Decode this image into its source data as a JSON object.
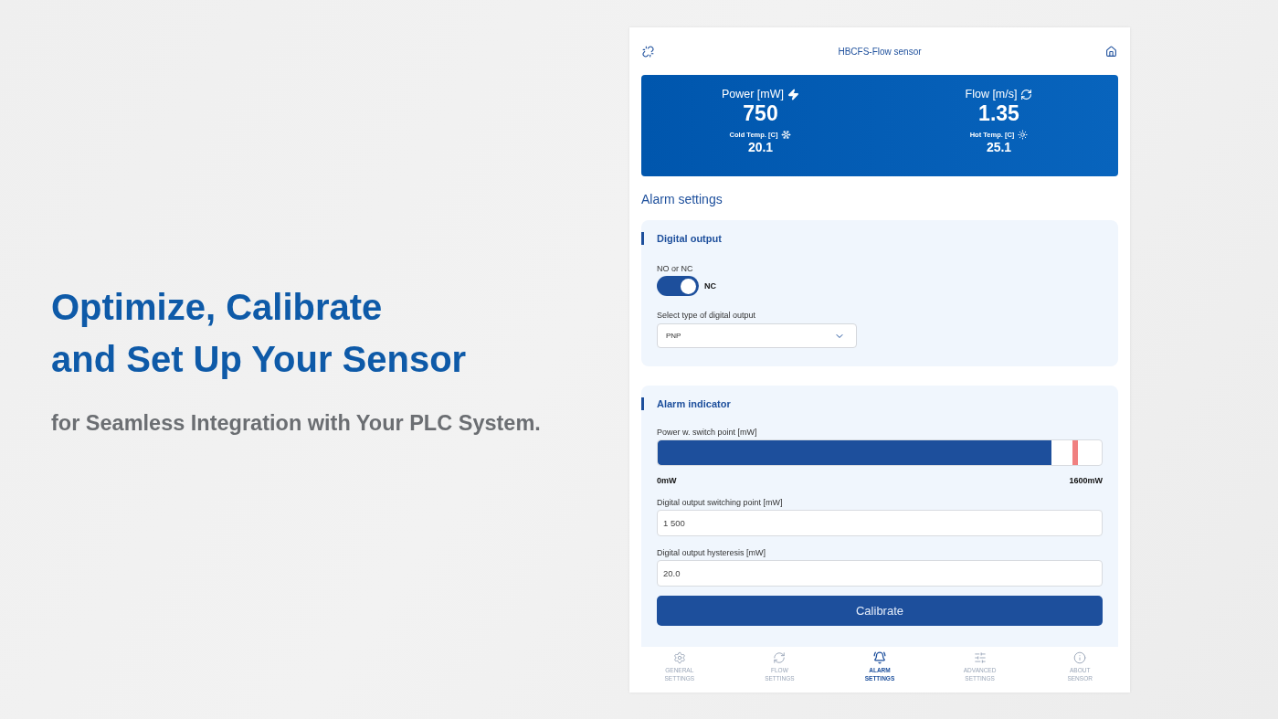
{
  "promo": {
    "headline": [
      "Optimize, Calibrate",
      "and Set Up Your Sensor"
    ],
    "subtitle": "for Seamless Integration with Your PLC System."
  },
  "app": {
    "title": "HBCFS-Flow sensor",
    "readings": [
      {
        "kind": "power",
        "label": "Power [mW]",
        "value": "750",
        "temperature": {
          "kind": "cold",
          "label": "Cold Temp. [C]",
          "value": "20.1"
        }
      },
      {
        "kind": "flow",
        "label": "Flow [m/s]",
        "value": "1.35",
        "temperature": {
          "kind": "hot",
          "label": "Hot Temp. [C]",
          "value": "25.1"
        }
      }
    ],
    "section_title": "Alarm settings",
    "digital_output": {
      "title": "Digital output",
      "toggle_label": "NO or NC",
      "toggle": {
        "on": true,
        "label": "NC"
      },
      "select_label": "Select type of digital output",
      "select_value": "PNP"
    },
    "alarm_indicator": {
      "title": "Alarm indicator",
      "bar_label": "Power w. switch point [mW]",
      "bar": {
        "level": 0.887
      },
      "switch_marker": {
        "level": 0.94
      },
      "min_label": "0mW",
      "max_label": "1600mW",
      "fields": [
        {
          "label": "Digital output switching point [mW]",
          "value": "1 500"
        },
        {
          "label": "Digital output hysteresis [mW]",
          "value": "20.0"
        }
      ],
      "button": "Calibrate"
    },
    "nav": [
      {
        "kind": "gear",
        "label": "GENERAL SETTINGS",
        "selected": false
      },
      {
        "kind": "refresh",
        "label": "FLOW SETTINGS",
        "selected": false
      },
      {
        "kind": "bell",
        "label": "ALARM SETTINGS",
        "selected": true
      },
      {
        "kind": "sliders",
        "label": "ADVANCED SETTINGS",
        "selected": false
      },
      {
        "kind": "info",
        "label": "ABOUT SENSOR",
        "selected": false
      }
    ]
  }
}
